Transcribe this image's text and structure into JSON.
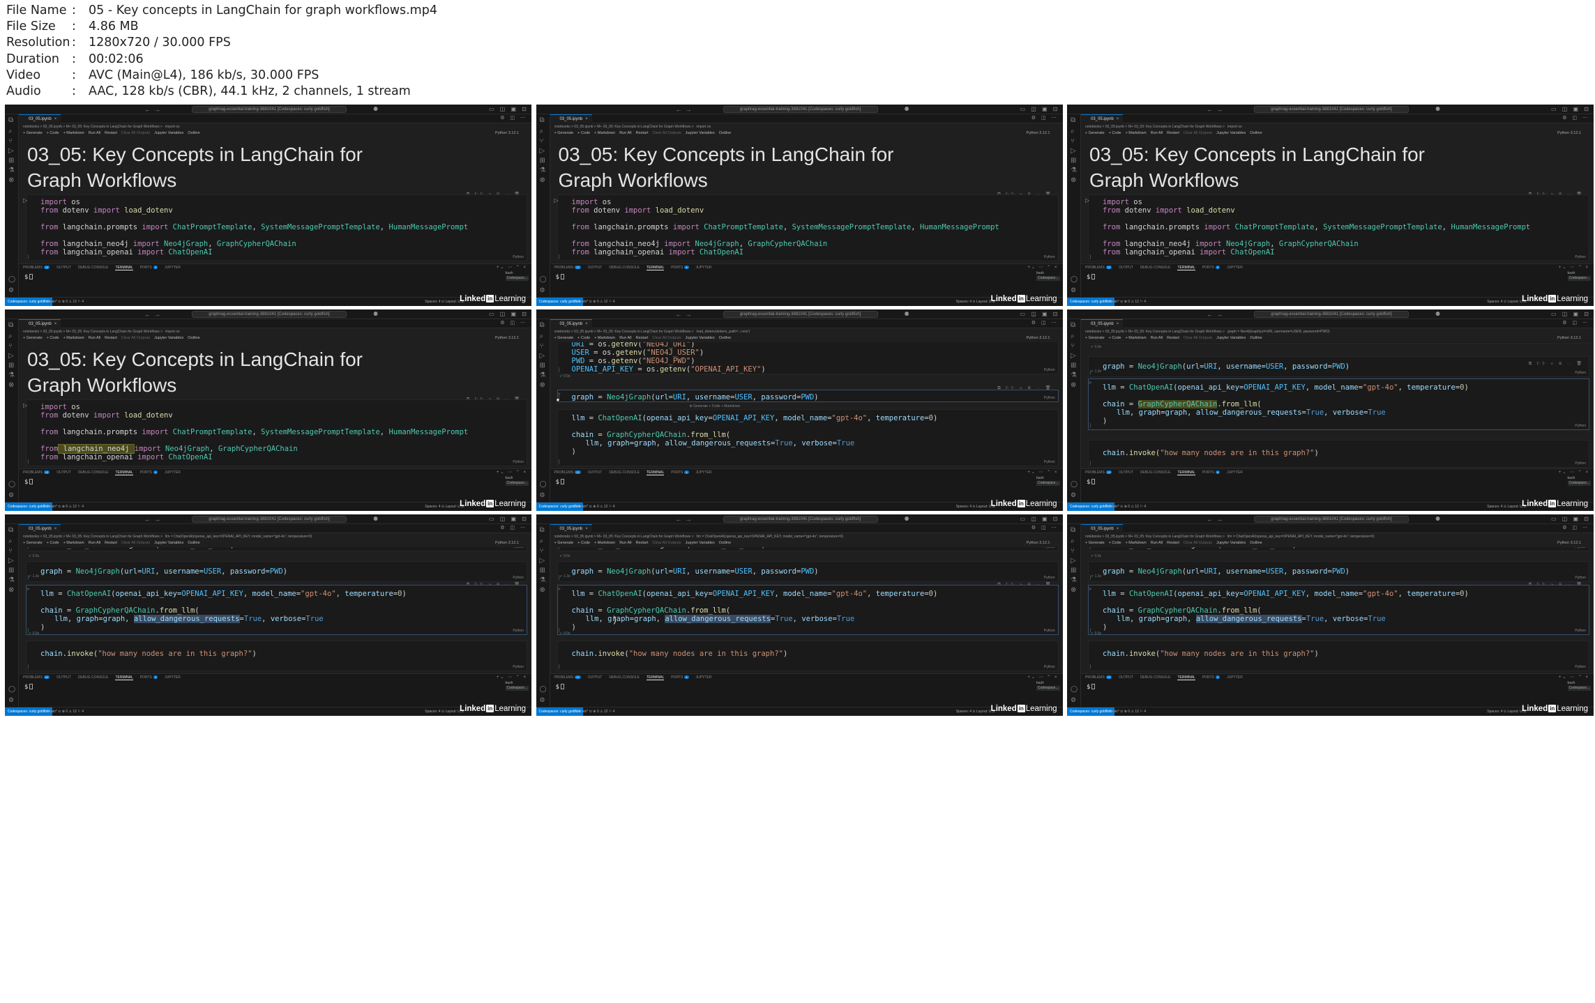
{
  "meta": [
    {
      "key": "File Name",
      "value": "05 - Key concepts in LangChain for graph workflows.mp4"
    },
    {
      "key": "File Size",
      "value": "4.86 MB"
    },
    {
      "key": "Resolution",
      "value": "1280x720 / 30.000 FPS"
    },
    {
      "key": "Duration",
      "value": "00:02:06"
    },
    {
      "key": "Video",
      "value": "AVC (Main@L4), 186 kb/s, 30.000 FPS"
    },
    {
      "key": "Audio",
      "value": "AAC, 128 kb/s (CBR), 44.1 kHz, 2 channels, 1 stream"
    }
  ],
  "meta_separator": ":",
  "ui": {
    "window_title": "graphrag-essential-training-3881041 [Codespaces: curly goldfish]",
    "tab_label": "03_05.ipynb",
    "breadcrumb_base": "notebooks > 03_05.ipynb > M+ 03_05: Key Concepts in LangChain for Graph Workflows >",
    "toolbar": {
      "generate": "+ Generate",
      "code": "+ Code",
      "markdown": "+ Markdown",
      "run_all": "Run All",
      "restart": "Restart",
      "clear_all": "Clear All Outputs",
      "jupyter_variables": "Jupyter Variables",
      "outline": "Outline",
      "kernel": "Python 3.12.1"
    },
    "cell_lang": "Python",
    "panel_tabs": [
      "PROBLEMS",
      "OUTPUT",
      "DEBUG CONSOLE",
      "TERMINAL",
      "PORTS",
      "JUPYTER"
    ],
    "problems_count": "12",
    "ports_count": "4",
    "term_prompt": "$",
    "term_list": [
      "bash",
      "Codespace..."
    ],
    "remote": "Codespaces: curly goldfish",
    "status_left": "main*  ⊙  ⊗ 0 ⚠ 12   ⚐ 4",
    "status_right": "Spaces: 4   ⊙   Layout: U.S.",
    "cell_of": [
      "Cell 2 of 7",
      "Cell 2 of 7",
      "Cell 2 of 7",
      "Cell 2 of 7",
      "Cell 3 of 7",
      "Cell 4 of 7",
      "Cell 5 of 7",
      "Cell 5 of 7",
      "Cell 5 of 7"
    ],
    "exec_status": [
      "0.0s",
      "1.3s",
      "0.0s"
    ],
    "ghost_actions": "⊕ Generate  + Code  + Markdown"
  },
  "code": {
    "title_md": "03_05: Key Concepts in LangChain for Graph Workflows",
    "imports": [
      [
        {
          "t": "import",
          "c": "kw"
        },
        {
          "t": " os",
          "c": ""
        }
      ],
      [
        {
          "t": "from",
          "c": "kw"
        },
        {
          "t": " dotenv ",
          "c": ""
        },
        {
          "t": "import",
          "c": "kw"
        },
        {
          "t": " load_dotenv",
          "c": "fn"
        }
      ],
      [],
      [
        {
          "t": "from",
          "c": "kw"
        },
        {
          "t": " langchain.prompts ",
          "c": ""
        },
        {
          "t": "import",
          "c": "kw"
        },
        {
          "t": " ChatPromptTemplate",
          "c": "cls"
        },
        {
          "t": ", ",
          "c": ""
        },
        {
          "t": "SystemMessagePromptTemplate",
          "c": "cls"
        },
        {
          "t": ", ",
          "c": ""
        },
        {
          "t": "HumanMessagePrompt",
          "c": "cls"
        }
      ],
      [],
      [
        {
          "t": "from",
          "c": "kw"
        },
        {
          "t": " langchain_neo4j ",
          "c": ""
        },
        {
          "t": "import",
          "c": "kw"
        },
        {
          "t": " Neo4jGraph",
          "c": "cls"
        },
        {
          "t": ", ",
          "c": ""
        },
        {
          "t": "GraphCypherQAChain",
          "c": "cls"
        }
      ],
      [
        {
          "t": "from",
          "c": "kw"
        },
        {
          "t": " langchain_openai ",
          "c": ""
        },
        {
          "t": "import",
          "c": "kw"
        },
        {
          "t": " ChatOpenAI",
          "c": "cls"
        }
      ]
    ],
    "env": [
      [
        {
          "t": "URI",
          "c": "const"
        },
        {
          "t": " = os.",
          "c": ""
        },
        {
          "t": "getenv",
          "c": "fn"
        },
        {
          "t": "(",
          "c": ""
        },
        {
          "t": "\"NEO4J_URI\"",
          "c": "str"
        },
        {
          "t": ")",
          "c": ""
        }
      ],
      [
        {
          "t": "USER",
          "c": "const"
        },
        {
          "t": " = os.",
          "c": ""
        },
        {
          "t": "getenv",
          "c": "fn"
        },
        {
          "t": "(",
          "c": ""
        },
        {
          "t": "\"NEO4J_USER\"",
          "c": "str"
        },
        {
          "t": ")",
          "c": ""
        }
      ],
      [
        {
          "t": "PWD",
          "c": "const"
        },
        {
          "t": " = os.",
          "c": ""
        },
        {
          "t": "getenv",
          "c": "fn"
        },
        {
          "t": "(",
          "c": ""
        },
        {
          "t": "\"NEO4J_PWD\"",
          "c": "str"
        },
        {
          "t": ")",
          "c": ""
        }
      ],
      [
        {
          "t": "OPENAI_API_KEY",
          "c": "const"
        },
        {
          "t": " = os.",
          "c": ""
        },
        {
          "t": "getenv",
          "c": "fn"
        },
        {
          "t": "(",
          "c": ""
        },
        {
          "t": "\"OPENAI_API_KEY\"",
          "c": "str"
        },
        {
          "t": ")",
          "c": ""
        }
      ]
    ],
    "graph": [
      [
        {
          "t": "graph",
          "c": "var"
        },
        {
          "t": " = ",
          "c": ""
        },
        {
          "t": "Neo4jGraph",
          "c": "cls"
        },
        {
          "t": "(",
          "c": ""
        },
        {
          "t": "url",
          "c": "param"
        },
        {
          "t": "=",
          "c": ""
        },
        {
          "t": "URI",
          "c": "const"
        },
        {
          "t": ", ",
          "c": ""
        },
        {
          "t": "username",
          "c": "param"
        },
        {
          "t": "=",
          "c": ""
        },
        {
          "t": "USER",
          "c": "const"
        },
        {
          "t": ", ",
          "c": ""
        },
        {
          "t": "password",
          "c": "param"
        },
        {
          "t": "=",
          "c": ""
        },
        {
          "t": "PWD",
          "c": "const"
        },
        {
          "t": ")",
          "c": ""
        }
      ]
    ],
    "llm": [
      [
        {
          "t": "llm",
          "c": "var"
        },
        {
          "t": " = ",
          "c": ""
        },
        {
          "t": "ChatOpenAI",
          "c": "cls"
        },
        {
          "t": "(",
          "c": ""
        },
        {
          "t": "openai_api_key",
          "c": "param"
        },
        {
          "t": "=",
          "c": ""
        },
        {
          "t": "OPENAI_API_KEY",
          "c": "const"
        },
        {
          "t": ", ",
          "c": ""
        },
        {
          "t": "model_name",
          "c": "param"
        },
        {
          "t": "=",
          "c": ""
        },
        {
          "t": "\"gpt-4o\"",
          "c": "str"
        },
        {
          "t": ", ",
          "c": ""
        },
        {
          "t": "temperature",
          "c": "param"
        },
        {
          "t": "=",
          "c": ""
        },
        {
          "t": "0",
          "c": "num"
        },
        {
          "t": ")",
          "c": ""
        }
      ]
    ],
    "chain1": [
      {
        "t": "chain",
        "c": "var"
      },
      {
        "t": " = ",
        "c": ""
      },
      {
        "t": "GraphCypherQAChain",
        "c": "cls"
      },
      {
        "t": ".",
        "c": ""
      },
      {
        "t": "from_llm",
        "c": "fn"
      },
      {
        "t": "(",
        "c": ""
      }
    ],
    "chain2": [
      {
        "t": "llm",
        "c": "var"
      },
      {
        "t": ", ",
        "c": ""
      },
      {
        "t": "graph",
        "c": "param"
      },
      {
        "t": "=",
        "c": ""
      },
      {
        "t": "graph",
        "c": "var"
      },
      {
        "t": ", ",
        "c": ""
      },
      {
        "t": "allow_dangerous_requests",
        "c": "param"
      },
      {
        "t": "=",
        "c": ""
      },
      {
        "t": "True",
        "c": "bool"
      },
      {
        "t": ", ",
        "c": ""
      },
      {
        "t": "verbose",
        "c": "param"
      },
      {
        "t": "=",
        "c": ""
      },
      {
        "t": "True",
        "c": "bool"
      }
    ],
    "chain3": [
      {
        "t": ")",
        "c": ""
      }
    ],
    "invoke": [
      [
        {
          "t": "chain",
          "c": "var"
        },
        {
          "t": ".",
          "c": ""
        },
        {
          "t": "invoke",
          "c": "fn"
        },
        {
          "t": "(",
          "c": ""
        },
        {
          "t": "\"how many nodes are in this graph?\"",
          "c": "str"
        },
        {
          "t": ")",
          "c": ""
        }
      ]
    ]
  },
  "frames": [
    {
      "variant": "title",
      "crumb_tail": "import os"
    },
    {
      "variant": "title",
      "crumb_tail": "import os"
    },
    {
      "variant": "title",
      "crumb_tail": "import os"
    },
    {
      "variant": "title-hl",
      "crumb_tail": "import os"
    },
    {
      "variant": "env-graph",
      "crumb_tail": "load_dotenv(dotenv_path='../.env')"
    },
    {
      "variant": "graph-llm",
      "crumb_tail": "graph = Neo4jGraph(url=URI, username=USER, password=PWD)"
    },
    {
      "variant": "llm-sel",
      "crumb_tail": "llm = ChatOpenAI(openai_api_key=OPENAI_API_KEY, model_name=\"gpt-4o\", temperature=0)"
    },
    {
      "variant": "llm-sel-cursor",
      "crumb_tail": "llm = ChatOpenAI(openai_api_key=OPENAI_API_KEY, model_name=\"gpt-4o\", temperature=0)"
    },
    {
      "variant": "llm-sel",
      "crumb_tail": "llm = ChatOpenAI(openai_api_key=OPENAI_API_KEY, model_name=\"gpt-4o\", temperature=0)"
    }
  ],
  "watermark": {
    "pre": "Linked",
    "in": "in",
    "post": "Learning"
  },
  "colors": {
    "accent": "#0078d4",
    "editor_bg": "#1f1f1f",
    "chrome_bg": "#181818"
  }
}
